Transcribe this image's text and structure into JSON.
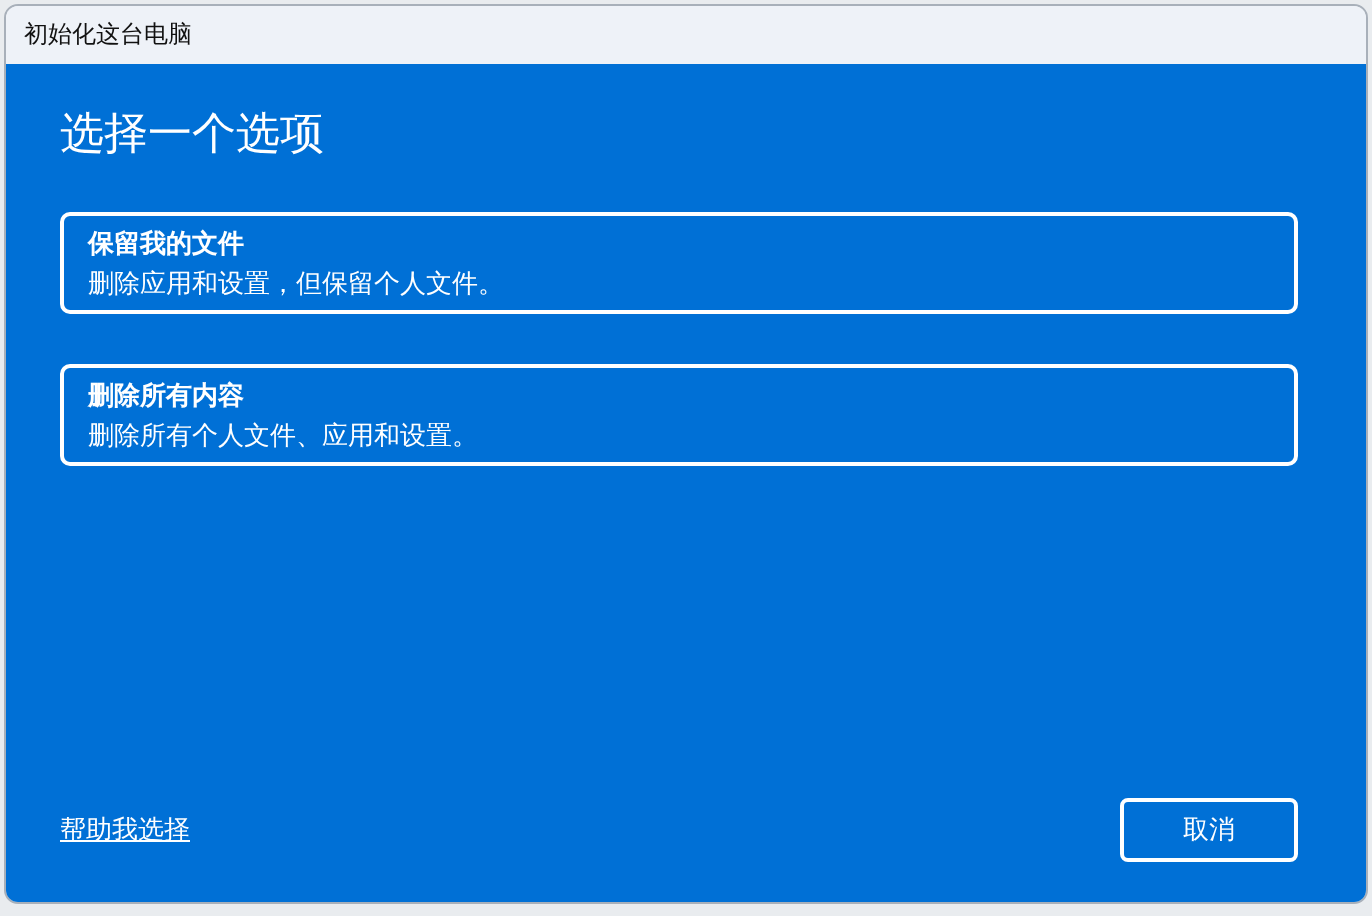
{
  "window": {
    "title": "初始化这台电脑"
  },
  "heading": "选择一个选项",
  "options": [
    {
      "title": "保留我的文件",
      "description": "删除应用和设置，但保留个人文件。"
    },
    {
      "title": "删除所有内容",
      "description": "删除所有个人文件、应用和设置。"
    }
  ],
  "help_link": "帮助我选择",
  "buttons": [
    "取消"
  ]
}
